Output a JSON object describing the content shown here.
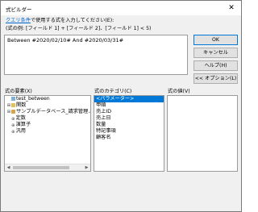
{
  "window": {
    "title": "式ビルダー",
    "close": "✕"
  },
  "instructions": {
    "link": "クエリ条件",
    "rest": "で使用する式を入力してください(E):",
    "example": "(式の例: [フィールド 1] + [フィールド 2]、[フィールド 1] < 5)"
  },
  "expression": {
    "value": "Between #2020/02/10# And #2020/03/31#"
  },
  "buttons": {
    "ok": "OK",
    "cancel": "キャンセル",
    "help": "ヘルプ(H)",
    "options": "<< オプション(L)"
  },
  "labels": {
    "elements": "式の要素(X)",
    "categories": "式のカテゴリ(C)",
    "values": "式の値(V)"
  },
  "elements": [
    {
      "label": "test_between",
      "expand": "",
      "icon": "table"
    },
    {
      "label": "関数",
      "expand": "⊞",
      "icon": "folder"
    },
    {
      "label": "サンプルデータベース_請求管理.accdb",
      "expand": "⊞",
      "icon": "db"
    },
    {
      "label": "定数",
      "expand": "",
      "icon": "plus"
    },
    {
      "label": "演算子",
      "expand": "",
      "icon": "plus"
    },
    {
      "label": "汎用",
      "expand": "",
      "icon": "plus"
    }
  ],
  "categories": [
    "<パラメーター>",
    "甲順",
    "売上ID",
    "売上日",
    "数量",
    "特記事項",
    "顧客名"
  ],
  "selected_category": "<パラメーター>"
}
